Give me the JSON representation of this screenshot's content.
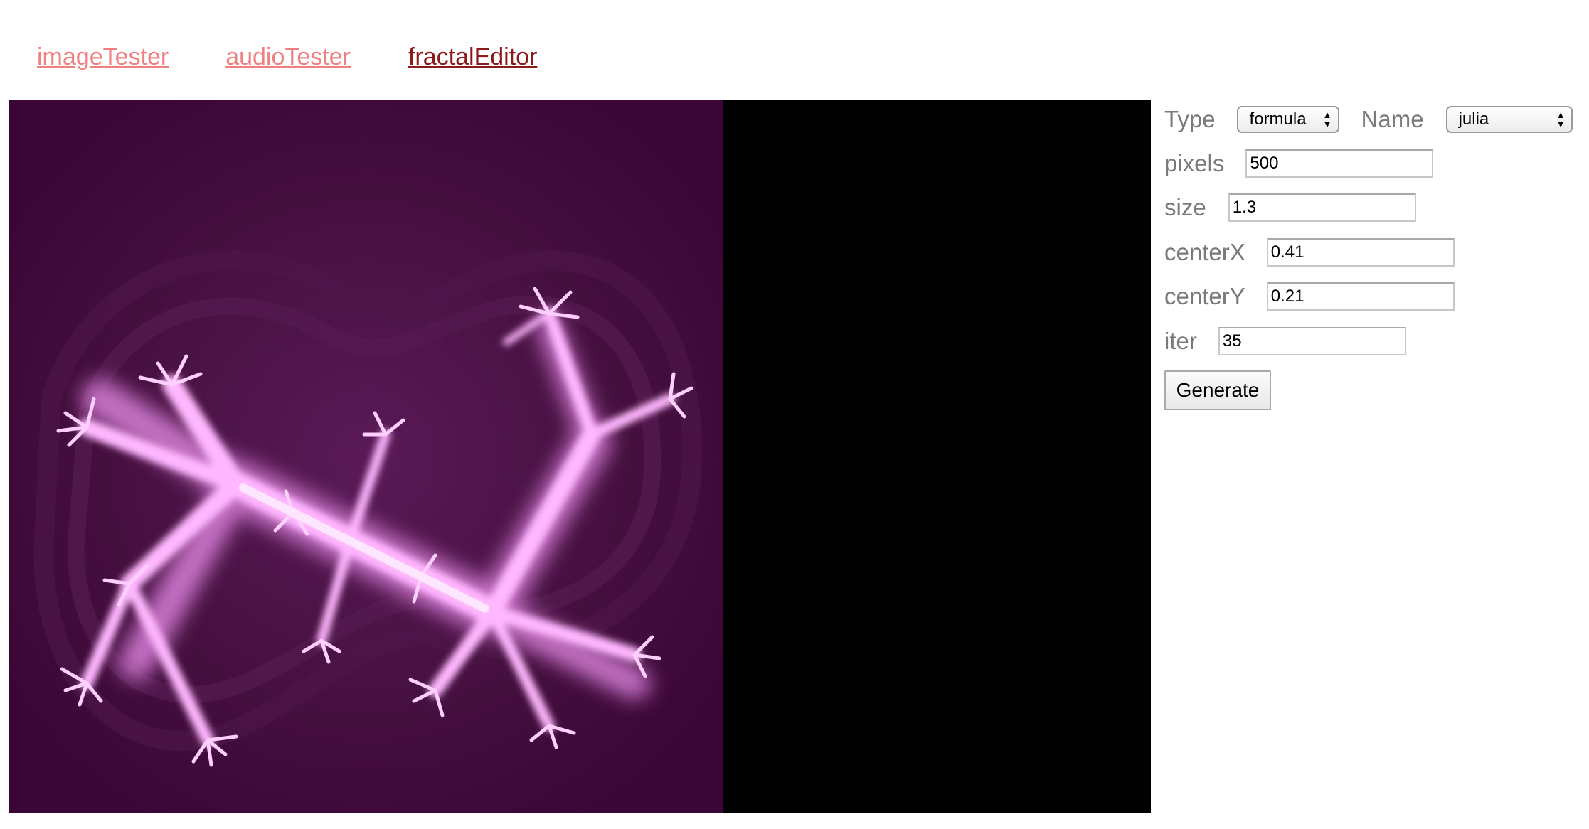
{
  "nav": {
    "items": [
      {
        "label": "imageTester",
        "state": "visited"
      },
      {
        "label": "audioTester",
        "state": "visited"
      },
      {
        "label": "fractalEditor",
        "state": "active"
      }
    ],
    "colors": {
      "visited": "#f08080",
      "active": "#8b1a1a"
    }
  },
  "viewer": {
    "fractal_background": "#3b0638",
    "fractal_glow": "#ffc0ff",
    "canvas_background": "#000000"
  },
  "controls": {
    "type_label": "Type",
    "type_value": "formula",
    "name_label": "Name",
    "name_value": "julia",
    "pixels_label": "pixels",
    "pixels_value": "500",
    "size_label": "size",
    "size_value": "1.3",
    "centerx_label": "centerX",
    "centerx_value": "0.41",
    "centery_label": "centerY",
    "centery_value": "0.21",
    "iter_label": "iter",
    "iter_value": "35",
    "generate_label": "Generate"
  }
}
